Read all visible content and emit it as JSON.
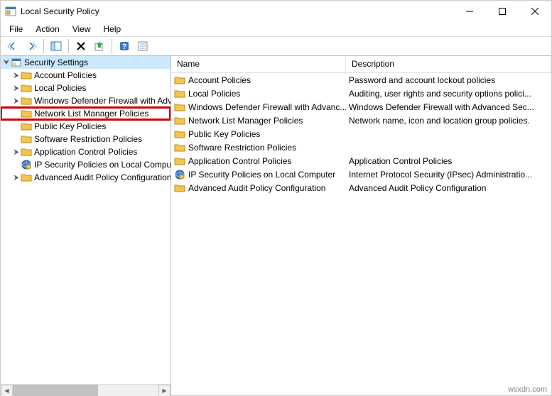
{
  "window": {
    "title": "Local Security Policy"
  },
  "menu": {
    "items": [
      "File",
      "Action",
      "View",
      "Help"
    ]
  },
  "tree": {
    "root": "Security Settings",
    "nodes": [
      {
        "label": "Account Policies",
        "icon": "folder"
      },
      {
        "label": "Local Policies",
        "icon": "folder"
      },
      {
        "label": "Windows Defender Firewall with Advanced Security",
        "icon": "folder"
      },
      {
        "label": "Network List Manager Policies",
        "icon": "folder",
        "highlighted": true,
        "expander": ""
      },
      {
        "label": "Public Key Policies",
        "icon": "folder",
        "expander": ""
      },
      {
        "label": "Software Restriction Policies",
        "icon": "folder",
        "expander": ""
      },
      {
        "label": "Application Control Policies",
        "icon": "folder"
      },
      {
        "label": "IP Security Policies on Local Computer",
        "icon": "ipsec",
        "expander": ""
      },
      {
        "label": "Advanced Audit Policy Configuration",
        "icon": "folder"
      }
    ]
  },
  "list": {
    "columns": {
      "name": "Name",
      "description": "Description"
    },
    "rows": [
      {
        "name": "Account Policies",
        "description": "Password and account lockout policies",
        "icon": "folder"
      },
      {
        "name": "Local Policies",
        "description": "Auditing, user rights and security options polici...",
        "icon": "folder"
      },
      {
        "name": "Windows Defender Firewall with Advanc...",
        "description": "Windows Defender Firewall with Advanced Sec...",
        "icon": "folder"
      },
      {
        "name": "Network List Manager Policies",
        "description": "Network name, icon and location group policies.",
        "icon": "folder"
      },
      {
        "name": "Public Key Policies",
        "description": "",
        "icon": "folder"
      },
      {
        "name": "Software Restriction Policies",
        "description": "",
        "icon": "folder"
      },
      {
        "name": "Application Control Policies",
        "description": "Application Control Policies",
        "icon": "folder"
      },
      {
        "name": "IP Security Policies on Local Computer",
        "description": "Internet Protocol Security (IPsec) Administratio...",
        "icon": "ipsec"
      },
      {
        "name": "Advanced Audit Policy Configuration",
        "description": "Advanced Audit Policy Configuration",
        "icon": "folder"
      }
    ]
  },
  "watermark": "wsxdn.com"
}
